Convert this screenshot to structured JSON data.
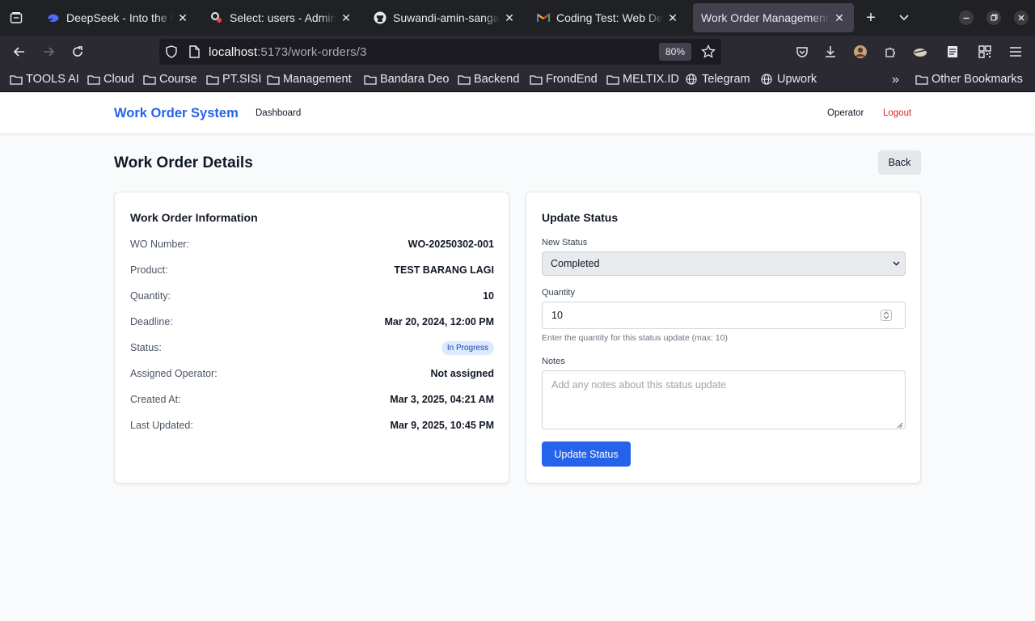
{
  "browser": {
    "tabs": [
      {
        "title": "DeepSeek - Into the Unknown",
        "icon": "deepseek-whale-icon",
        "active": false
      },
      {
        "title": "Select: users - Adminer",
        "icon": "adminer-icon",
        "active": false
      },
      {
        "title": "Suwandi-amin-sangaji/",
        "icon": "github-icon",
        "active": false
      },
      {
        "title": "Coding Test: Web Developer",
        "icon": "gmail-icon",
        "active": false
      },
      {
        "title": "Work Order Management",
        "icon": "none",
        "active": true
      }
    ],
    "url_host": "localhost",
    "url_path": ":5173/work-orders/3",
    "zoom": "80%",
    "bookmarks": [
      "TOOLS AI",
      "Cloud",
      "Course",
      "PT.SISI",
      "Management",
      "Bandara Deo",
      "Backend",
      "FrondEnd",
      "MELTIX.ID",
      "Telegram",
      "Upwork"
    ],
    "other_bookmarks": "Other Bookmarks"
  },
  "header": {
    "brand": "Work Order System",
    "nav_dashboard": "Dashboard",
    "user_role": "Operator",
    "logout": "Logout"
  },
  "page": {
    "title": "Work Order Details",
    "back_label": "Back"
  },
  "info": {
    "title": "Work Order Information",
    "rows": [
      {
        "label": "WO Number:",
        "value": "WO-20250302-001"
      },
      {
        "label": "Product:",
        "value": "TEST BARANG LAGI"
      },
      {
        "label": "Quantity:",
        "value": "10"
      },
      {
        "label": "Deadline:",
        "value": "Mar 20, 2024, 12:00 PM"
      },
      {
        "label": "Status:",
        "value": "In Progress"
      },
      {
        "label": "Assigned Operator:",
        "value": "Not assigned"
      },
      {
        "label": "Created At:",
        "value": "Mar 3, 2025, 04:21 AM"
      },
      {
        "label": "Last Updated:",
        "value": "Mar 9, 2025, 10:45 PM"
      }
    ]
  },
  "update": {
    "title": "Update Status",
    "status_label": "New Status",
    "status_value": "Completed",
    "quantity_label": "Quantity",
    "quantity_value": "10",
    "quantity_help": "Enter the quantity for this status update (max: 10)",
    "notes_label": "Notes",
    "notes_placeholder": "Add any notes about this status update",
    "submit_label": "Update Status"
  },
  "colors": {
    "brand": "#2563eb",
    "logout": "#dc2626",
    "badge_bg": "#dbeafe",
    "badge_text": "#1e40af"
  }
}
